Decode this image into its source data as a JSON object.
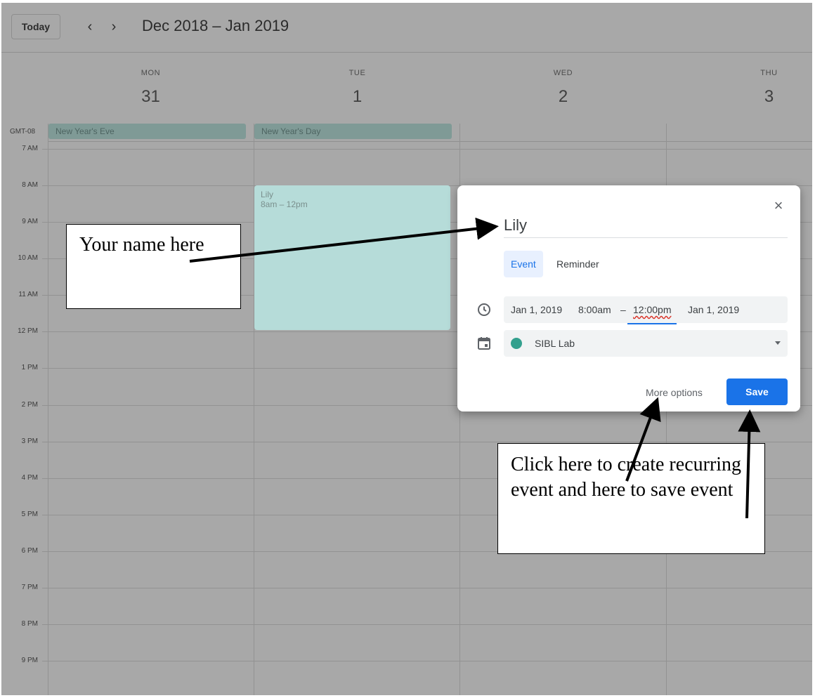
{
  "toolbar": {
    "today_label": "Today",
    "prev_icon": "chevron-left-icon",
    "next_icon": "chevron-right-icon",
    "range_title": "Dec 2018 – Jan 2019"
  },
  "week": {
    "days": [
      {
        "name": "MON",
        "num": "31"
      },
      {
        "name": "TUE",
        "num": "1"
      },
      {
        "name": "WED",
        "num": "2"
      },
      {
        "name": "THU",
        "num": "3"
      }
    ],
    "timezone": "GMT-08",
    "all_day_events": [
      {
        "label": "New Year's Eve"
      },
      {
        "label": "New Year's Day"
      }
    ],
    "hours": [
      "7 AM",
      "8 AM",
      "9 AM",
      "10 AM",
      "11 AM",
      "12 PM",
      "1 PM",
      "2 PM",
      "3 PM",
      "4 PM",
      "5 PM",
      "6 PM",
      "7 PM",
      "8 PM",
      "9 PM"
    ]
  },
  "event": {
    "title": "Lily",
    "time": "8am – 12pm",
    "color": "#b6dcd9"
  },
  "dialog": {
    "title_value": "Lily",
    "tabs": [
      {
        "label": "Event",
        "selected": true
      },
      {
        "label": "Reminder",
        "selected": false
      }
    ],
    "start_date": "Jan 1, 2019",
    "start_time": "8:00am",
    "dash": "–",
    "end_time": "12:00pm",
    "end_date": "Jan 1, 2019",
    "calendar_name": "SIBL Lab",
    "calendar_color": "#33a08e",
    "more_options_label": "More options",
    "save_label": "Save",
    "accent_color": "#1a73e8"
  },
  "annotations": {
    "name_note": "Your name here",
    "save_note": "Click here to create recurring event and here to save event"
  }
}
